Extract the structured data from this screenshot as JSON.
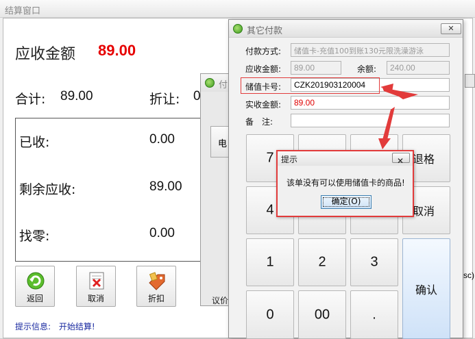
{
  "main": {
    "title": "结算窗口",
    "receivable_label": "应收金额",
    "receivable_value": "89.00",
    "total_label": "合计:",
    "total_value": "89.00",
    "discount_label": "折让:",
    "discount_value_partial": "0",
    "received_label": "已收:",
    "received_value": "0.00",
    "remaining_label": "剩余应收:",
    "remaining_value": "89.00",
    "change_label": "找零:",
    "change_value": "0.00",
    "buttons": [
      {
        "label": "返回",
        "icon": "refresh-icon"
      },
      {
        "label": "取消",
        "icon": "cancel-doc-icon"
      },
      {
        "label": "折扣",
        "icon": "discount-tag-icon"
      }
    ],
    "tip_label": "提示信息:",
    "tip_text": "开始结算!"
  },
  "pay_window": {
    "title_partial": "付",
    "side_button_partial": "电",
    "bottom_label_partial": "议价"
  },
  "other_payment": {
    "title": "其它付款",
    "close_label": "✕",
    "payment_method_label": "付款方式:",
    "payment_method_value": "储值卡-充值100到账130元限洗澡游泳",
    "receivable_label": "应收金额:",
    "receivable_value": "89.00",
    "balance_label": "余额:",
    "balance_value": "240.00",
    "card_no_label": "储值卡号:",
    "card_no_value": "CZK201903120004",
    "actual_label": "实收金额:",
    "actual_value": "89.00",
    "remark_label": "备　注:",
    "remark_value": "",
    "keys": {
      "k7": "7",
      "k4": "4",
      "k1": "1",
      "k2": "2",
      "k3": "3",
      "k0": "0",
      "k00": "00",
      "kdot": ".",
      "backspace": "退格",
      "cancel": "取消",
      "confirm": "确认"
    }
  },
  "prompt": {
    "title": "提示",
    "close_label": "✕",
    "message": "该单没有可以使用储值卡的商品!",
    "ok_label": "确定(O)"
  },
  "edge_partial_text": "sc)"
}
